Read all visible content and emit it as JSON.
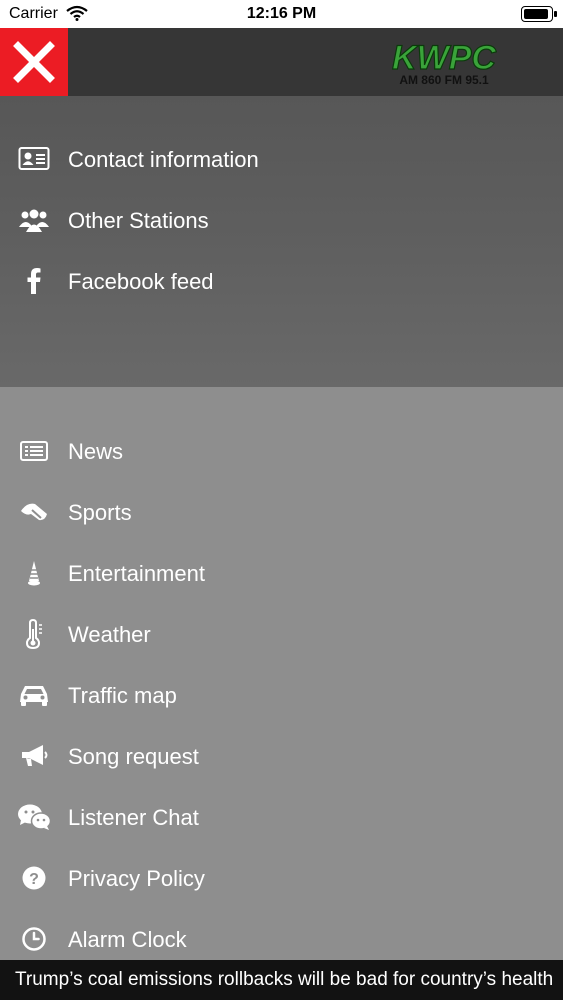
{
  "status_bar": {
    "carrier": "Carrier",
    "time": "12:16 PM"
  },
  "header": {
    "logo_main": "KWPC",
    "logo_sub": "AM 860 FM 95.1",
    "brand_color": "#3aa33a",
    "close_color": "#ec1c24"
  },
  "menu": {
    "primary": [
      {
        "label": "Contact information",
        "icon": "contact-card-icon"
      },
      {
        "label": "Other Stations",
        "icon": "users-icon"
      },
      {
        "label": "Facebook feed",
        "icon": "facebook-icon"
      }
    ],
    "secondary": [
      {
        "label": "News",
        "icon": "newspaper-icon"
      },
      {
        "label": "Sports",
        "icon": "sports-icon"
      },
      {
        "label": "Entertainment",
        "icon": "entertainment-icon"
      },
      {
        "label": "Weather",
        "icon": "thermometer-icon"
      },
      {
        "label": "Traffic map",
        "icon": "car-icon"
      },
      {
        "label": "Song request",
        "icon": "megaphone-icon"
      },
      {
        "label": "Listener Chat",
        "icon": "chat-icon"
      },
      {
        "label": "Privacy Policy",
        "icon": "question-icon"
      },
      {
        "label": "Alarm Clock",
        "icon": "clock-icon"
      }
    ]
  },
  "ticker": {
    "text": "Trump’s coal emissions rollbacks will be bad for country’s health"
  }
}
